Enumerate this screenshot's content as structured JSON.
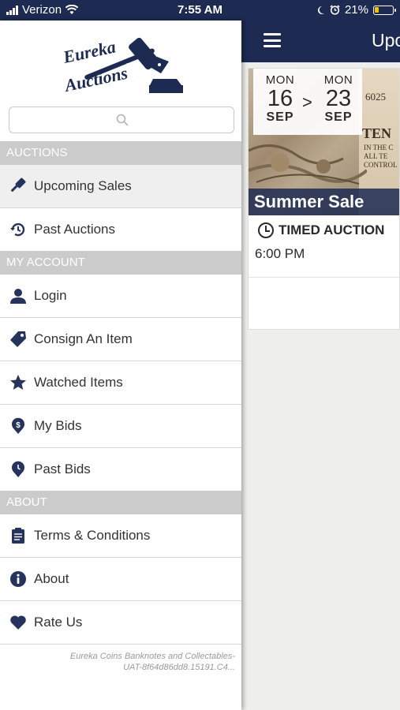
{
  "status_bar": {
    "carrier": "Verizon",
    "time": "7:55 AM",
    "battery": "21%"
  },
  "main": {
    "title": "Upcoming Sales",
    "sale": {
      "start_dow": "MON",
      "start_day": "16",
      "start_month": "SEP",
      "separator": ">",
      "end_dow": "MON",
      "end_day": "23",
      "end_month": "SEP",
      "name": "Summer Sale",
      "type": "TIMED AUCTION",
      "time": "6:00 PM"
    }
  },
  "drawer": {
    "logo_text": [
      "Eureka",
      "Auctions"
    ],
    "search": {
      "placeholder": ""
    },
    "sections": {
      "auctions": "AUCTIONS",
      "my_account": "MY ACCOUNT",
      "about": "ABOUT"
    },
    "items": [
      {
        "label": "Upcoming Sales",
        "icon": "gavel-icon"
      },
      {
        "label": "Past Auctions",
        "icon": "history-icon"
      },
      {
        "label": "Login",
        "icon": "user-icon"
      },
      {
        "label": "Consign An Item",
        "icon": "tag-icon"
      },
      {
        "label": "Watched Items",
        "icon": "star-icon"
      },
      {
        "label": "My Bids",
        "icon": "dollar-pin-icon"
      },
      {
        "label": "Past Bids",
        "icon": "clock-pin-icon"
      },
      {
        "label": "Terms & Conditions",
        "icon": "clipboard-icon"
      },
      {
        "label": "About",
        "icon": "info-icon"
      },
      {
        "label": "Rate Us",
        "icon": "heart-icon"
      }
    ],
    "footer": {
      "line1": "Eureka Coins Banknotes and Collectables-",
      "line2": "UAT-8f64d86dd8.15191.C4..."
    }
  },
  "colors": {
    "brand_navy": "#1d2a52",
    "section_gray": "#cbcbcb"
  }
}
